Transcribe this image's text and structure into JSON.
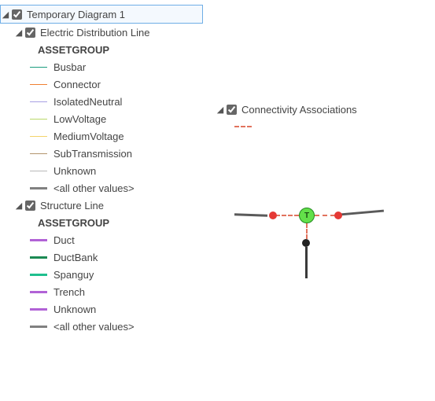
{
  "left": {
    "root": "Temporary Diagram 1",
    "layer1": {
      "name": "Electric Distribution Line",
      "heading": "ASSETGROUP",
      "items": [
        {
          "label": "Busbar",
          "color": "#1a9d7e",
          "w": 1
        },
        {
          "label": "Connector",
          "color": "#f07f31",
          "w": 1
        },
        {
          "label": "IsolatedNeutral",
          "color": "#a89fe4",
          "w": 1
        },
        {
          "label": "LowVoltage",
          "color": "#b9d86a",
          "w": 1
        },
        {
          "label": "MediumVoltage",
          "color": "#f4d36a",
          "w": 1
        },
        {
          "label": "SubTransmission",
          "color": "#b3956d",
          "w": 1
        },
        {
          "label": "Unknown",
          "color": "#b9b9b9",
          "w": 1
        }
      ],
      "other": {
        "label": "<all other values>",
        "color": "#808080",
        "w": 3
      }
    },
    "layer2": {
      "name": "Structure Line",
      "heading": "ASSETGROUP",
      "items": [
        {
          "label": "Duct",
          "color": "#b162d6",
          "w": 3
        },
        {
          "label": "DuctBank",
          "color": "#1b8a53",
          "w": 3
        },
        {
          "label": "Spanguy",
          "color": "#1fbf8e",
          "w": 3
        },
        {
          "label": "Trench",
          "color": "#b162d6",
          "w": 3
        },
        {
          "label": "Unknown",
          "color": "#b162d6",
          "w": 3
        }
      ],
      "other": {
        "label": "<all other values>",
        "color": "#808080",
        "w": 3
      }
    }
  },
  "right": {
    "layer": "Connectivity Associations",
    "swatch_color": "#e2735e",
    "swatch_dashed": true
  },
  "diagram": {
    "center_label": "T"
  }
}
